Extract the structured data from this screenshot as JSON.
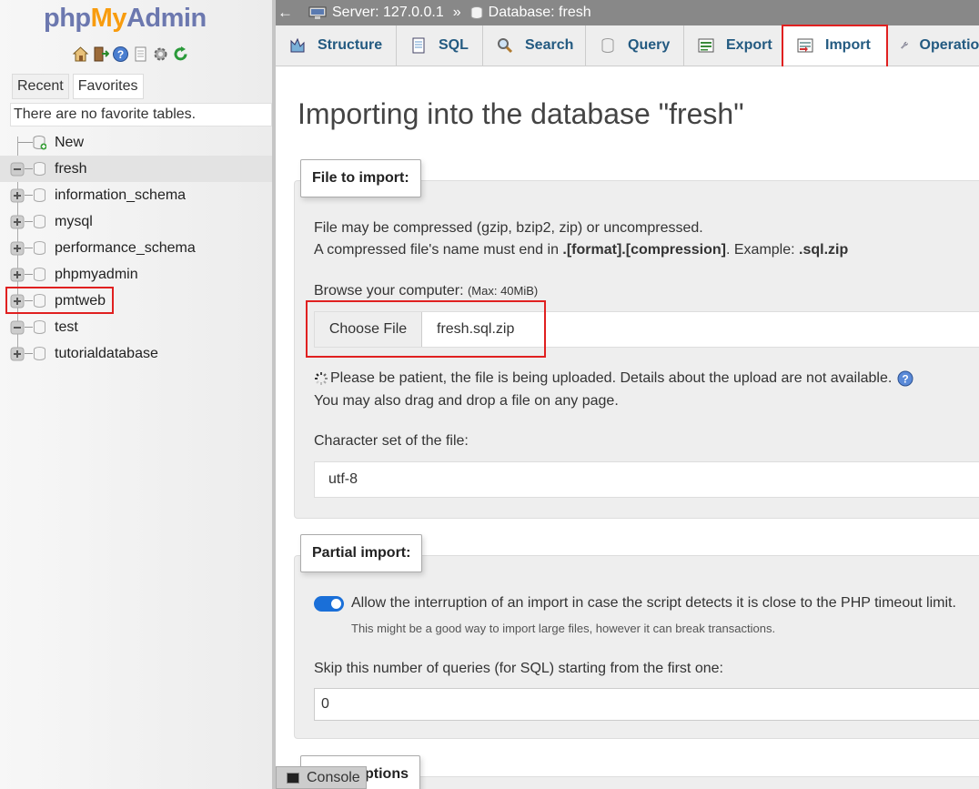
{
  "sidebar": {
    "logo": {
      "part1": "php",
      "part2": "My",
      "part3": "Admin"
    },
    "quick_icons": [
      "home-icon",
      "logout-icon",
      "help-icon",
      "docs-icon",
      "settings-icon",
      "reload-icon"
    ],
    "tabs": {
      "recent": "Recent",
      "favorites": "Favorites"
    },
    "favorites_empty": "There are no favorite tables.",
    "tree": [
      {
        "label": "New",
        "kind": "new"
      },
      {
        "label": "fresh",
        "kind": "collapse",
        "selected": true
      },
      {
        "label": "information_schema",
        "kind": "expand"
      },
      {
        "label": "mysql",
        "kind": "expand"
      },
      {
        "label": "performance_schema",
        "kind": "expand"
      },
      {
        "label": "phpmyadmin",
        "kind": "expand"
      },
      {
        "label": "pmtweb",
        "kind": "expand"
      },
      {
        "label": "test",
        "kind": "collapse"
      },
      {
        "label": "tutorialdatabase",
        "kind": "expand"
      }
    ]
  },
  "topbar": {
    "back": "←",
    "server": "Server: 127.0.0.1",
    "separator": "»",
    "database": "Database: fresh"
  },
  "tabs": [
    {
      "label": "Structure",
      "icon": "structure-icon"
    },
    {
      "label": "SQL",
      "icon": "sql-icon"
    },
    {
      "label": "Search",
      "icon": "search-icon"
    },
    {
      "label": "Query",
      "icon": "query-icon"
    },
    {
      "label": "Export",
      "icon": "export-icon"
    },
    {
      "label": "Import",
      "icon": "import-icon",
      "active": true
    },
    {
      "label": "Operations",
      "icon": "wrench-icon"
    }
  ],
  "main": {
    "title": "Importing into the database \"fresh\"",
    "file_section": {
      "legend": "File to import:",
      "line1": "File may be compressed (gzip, bzip2, zip) or uncompressed.",
      "line2_pre": "A compressed file's name must end in ",
      "line2_bold": ".[format].[compression]",
      "line2_mid": ". Example: ",
      "line2_example": ".sql.zip",
      "browse_label": "Browse your computer: ",
      "max_size": "(Max: 40MiB)",
      "choose_file": "Choose File",
      "file_name": "fresh.sql.zip",
      "upload_msg": "Please be patient, the file is being uploaded. Details about the upload are not available.",
      "drag_drop": "You may also drag and drop a file on any page.",
      "charset_label": "Character set of the file:",
      "charset_value": "utf-8"
    },
    "partial_section": {
      "legend": "Partial import:",
      "allow_interrupt": "Allow the interruption of an import in case the script detects it is close to the PHP timeout limit.",
      "allow_hint": "This might be a good way to import large files, however it can break transactions.",
      "allow_enabled": true,
      "skip_label": "Skip this number of queries (for SQL) starting from the first one:",
      "skip_value": "0"
    },
    "other_section": {
      "legend_visible": "ptions"
    }
  },
  "console": {
    "label": "Console"
  },
  "colors": {
    "accent_link": "#235a81",
    "highlight": "#e02020",
    "toggle_on": "#1a6fd8"
  }
}
